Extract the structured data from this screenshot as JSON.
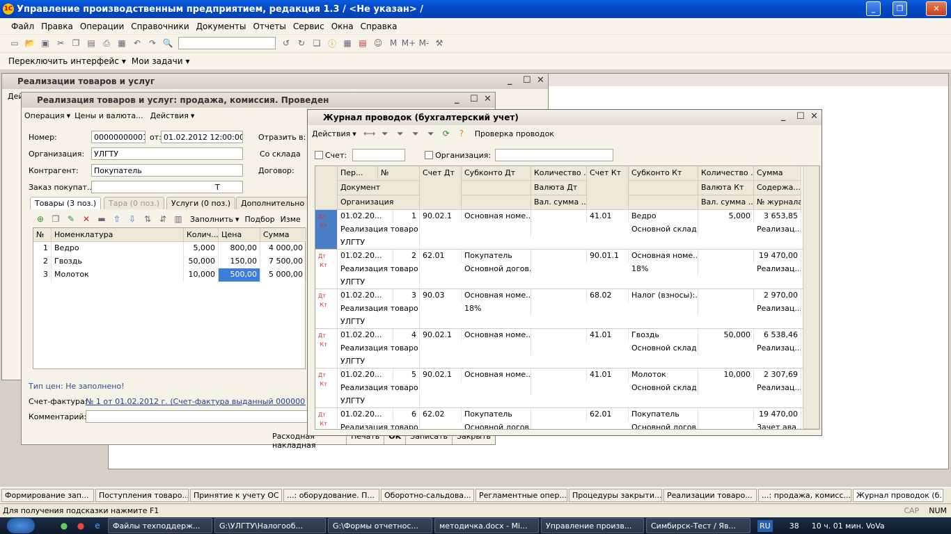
{
  "app": {
    "title": "Управление производственным предприятием, редакция 1.3 / <Не указан> /",
    "logo": "1С",
    "win_buttons": [
      "_",
      "❐",
      "✕"
    ]
  },
  "menu": [
    "Файл",
    "Правка",
    "Операции",
    "Справочники",
    "Документы",
    "Отчеты",
    "Сервис",
    "Окна",
    "Справка"
  ],
  "toolbar2": {
    "switch": "Переключить интерфейс",
    "tasks": "Мои задачи"
  },
  "toolbar_text": {
    "m1": "M",
    "m2": "M+",
    "m3": "M-"
  },
  "win_list": {
    "title": "Реализации товаров и услуг",
    "tab_actions": "Дей"
  },
  "doc": {
    "title": "Реализация товаров и услуг: продажа, комиссия. Проведен",
    "menu": [
      "Операция",
      "Цены и валюта...",
      "Действия"
    ],
    "labels": {
      "number": "Номер:",
      "from": "от:",
      "org": "Организация:",
      "contr": "Контрагент:",
      "order": "Заказ покупат...",
      "reflect": "Отразить в:",
      "warehouse": "Со склада",
      "contract": "Договор:",
      "price_type": "Тип цен: Не заполнено!",
      "invoice": "Счет-фактура:",
      "comment": "Комментарий:"
    },
    "values": {
      "number": "00000000001",
      "date": "01.02.2012 12:00:00",
      "org": "УЛГТУ",
      "contr": "Покупатель",
      "order_btn": "T",
      "invoice": "№ 1 от 01.02.2012 г. (Счет-фактура выданный 000000000001 от"
    },
    "tabs": [
      "Товары (3 поз.)",
      "Тара (0 поз.)",
      "Услуги (0 поз.)",
      "Дополнительно"
    ],
    "table_toolbar": {
      "fill": "Заполнить",
      "select": "Подбор",
      "change": "Изме"
    },
    "columns": [
      "№",
      "Номенклатура",
      "Колич...",
      "Цена",
      "Сумма"
    ],
    "rows": [
      {
        "n": "1",
        "name": "Ведро",
        "qty": "5,000",
        "price": "800,00",
        "sum": "4 000,00"
      },
      {
        "n": "2",
        "name": "Гвоздь",
        "qty": "50,000",
        "price": "150,00",
        "sum": "7 500,00"
      },
      {
        "n": "3",
        "name": "Молоток",
        "qty": "10,000",
        "price": "500,00",
        "sum": "5 000,00"
      }
    ],
    "buttons": [
      "Расходная накладная",
      "Печать",
      "OK",
      "Записать",
      "Закрыть"
    ]
  },
  "journal": {
    "title": "Журнал проводок (бухгалтерский учет)",
    "actions": "Действия",
    "check": "Проверка проводок",
    "filter_account": "Счет:",
    "filter_org": "Организация:",
    "headers1": [
      "Пер...",
      "№",
      "Счет Дт",
      "Субконто Дт",
      "Количество ...",
      "Счет Кт",
      "Субконто Кт",
      "Количество ...",
      "Сумма"
    ],
    "headers2": [
      "Документ",
      "Валюта Дт",
      "Валюта Кт",
      "Содержа..."
    ],
    "headers3": [
      "Организация",
      "Вал. сумма ...",
      "Вал. сумма ...",
      "№ журнала"
    ],
    "entries": [
      {
        "date": "01.02.20...",
        "n": "1",
        "dt": "90.02.1",
        "sdt1": "Основная номе...",
        "sdt2": "",
        "qdt": "",
        "kt": "41.01",
        "skt1": "Ведро",
        "skt2": "Основной склад",
        "qkt": "5,000",
        "sum": "3 653,85",
        "doc": "Реализация товаро...",
        "cont": "Реализац...",
        "org": "УЛГТУ"
      },
      {
        "date": "01.02.20...",
        "n": "2",
        "dt": "62.01",
        "sdt1": "Покупатель",
        "sdt2": "Основной догов...",
        "qdt": "",
        "kt": "90.01.1",
        "skt1": "Основная номе...",
        "skt2": "18%",
        "qkt": "",
        "sum": "19 470,00",
        "doc": "Реализация товаро...",
        "cont": "Реализац...",
        "org": "УЛГТУ"
      },
      {
        "date": "01.02.20...",
        "n": "3",
        "dt": "90.03",
        "sdt1": "Основная номе...",
        "sdt2": "18%",
        "qdt": "",
        "kt": "68.02",
        "skt1": "Налог (взносы):...",
        "skt2": "",
        "qkt": "",
        "sum": "2 970,00",
        "doc": "Реализация товаро...",
        "cont": "Реализац...",
        "org": "УЛГТУ"
      },
      {
        "date": "01.02.20...",
        "n": "4",
        "dt": "90.02.1",
        "sdt1": "Основная номе...",
        "sdt2": "",
        "qdt": "",
        "kt": "41.01",
        "skt1": "Гвоздь",
        "skt2": "Основной склад",
        "qkt": "50,000",
        "sum": "6 538,46",
        "doc": "Реализация товаро...",
        "cont": "Реализац...",
        "org": "УЛГТУ"
      },
      {
        "date": "01.02.20...",
        "n": "5",
        "dt": "90.02.1",
        "sdt1": "Основная номе...",
        "sdt2": "",
        "qdt": "",
        "kt": "41.01",
        "skt1": "Молоток",
        "skt2": "Основной склад",
        "qkt": "10,000",
        "sum": "2 307,69",
        "doc": "Реализация товаро...",
        "cont": "Реализац...",
        "org": "УЛГТУ"
      },
      {
        "date": "01.02.20...",
        "n": "6",
        "dt": "62.02",
        "sdt1": "Покупатель",
        "sdt2": "Основной догов...",
        "qdt": "",
        "kt": "62.01",
        "skt1": "Покупатель",
        "skt2": "Основной догов...",
        "qkt": "",
        "sum": "19 470,00",
        "doc": "Реализация товаро...",
        "cont": "Зачет ава...",
        "org": ""
      }
    ]
  },
  "taskbar": [
    "Формирование зап...",
    "Поступления товаро...",
    "Принятие к учету ОС",
    "...: оборудование. П...",
    "Оборотно-сальдова...",
    "Регламентные опер...",
    "Процедуры закрыти...",
    "Реализации товаро...",
    "...: продажа, комисс...",
    "Журнал проводок (б..."
  ],
  "status": {
    "hint": "Для получения подсказки нажмите F1",
    "cap": "CAP",
    "num": "NUM"
  },
  "windows_taskbar": {
    "items": [
      "Файлы техподдерж...",
      "G:\\УЛГТУ\\Налогооб...",
      "G:\\Формы отчетнос...",
      "методичка.docx - Mi...",
      "Управление произв...",
      "Симбирск-Тест / Яв..."
    ],
    "lang": "RU",
    "battery": "38",
    "clock": "10 ч. 01 мин. VoVa"
  }
}
